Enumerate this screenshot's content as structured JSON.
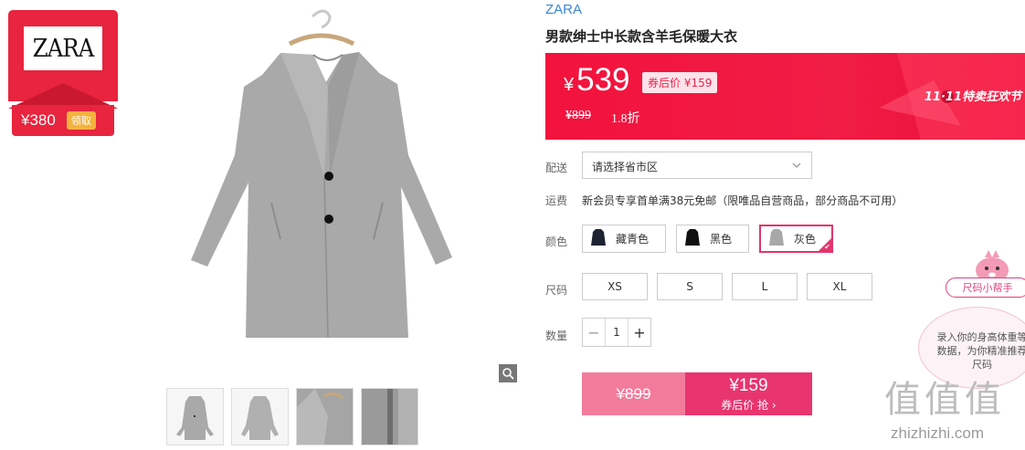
{
  "coupon_badge": {
    "brand": "ZARA",
    "amount": "¥380",
    "action": "领取"
  },
  "product": {
    "brand": "ZARA",
    "title": "男款绅士中长款含羊毛保暖大衣"
  },
  "price": {
    "symbol": "¥",
    "current": "539",
    "after_coupon": "券后价 ¥159",
    "original": "¥899",
    "discount": "1.8折",
    "festival": "11·11特卖狂欢节"
  },
  "delivery": {
    "label": "配送",
    "placeholder": "请选择省市区"
  },
  "shipping": {
    "label": "运费",
    "text": "新会员专享首单满38元免邮（限唯品自营商品，部分商品不可用）"
  },
  "colors": {
    "label": "颜色",
    "options": [
      {
        "name": "藏青色",
        "swatch": "#1d2330",
        "selected": false
      },
      {
        "name": "黑色",
        "swatch": "#111111",
        "selected": false
      },
      {
        "name": "灰色",
        "swatch": "#a8a8a8",
        "selected": true
      }
    ]
  },
  "sizes": {
    "label": "尺码",
    "options": [
      "XS",
      "S",
      "L",
      "XL"
    ]
  },
  "quantity": {
    "label": "数量",
    "value": "1",
    "minus": "−",
    "plus": "+"
  },
  "buy": {
    "original": "¥899",
    "price": "¥159",
    "cta": "券后价 抢 ›"
  },
  "size_helper": {
    "button": "尺码小帮手",
    "bubble": "录入你的身高体重等数据，为你精准推荐尺码"
  },
  "watermark": {
    "glyphs": "值值值",
    "url": "zhizhizhi.com"
  },
  "colors_theme": {
    "accent": "#e8244a",
    "brand_link": "#3a86d6",
    "selected_border": "#e2356e"
  }
}
